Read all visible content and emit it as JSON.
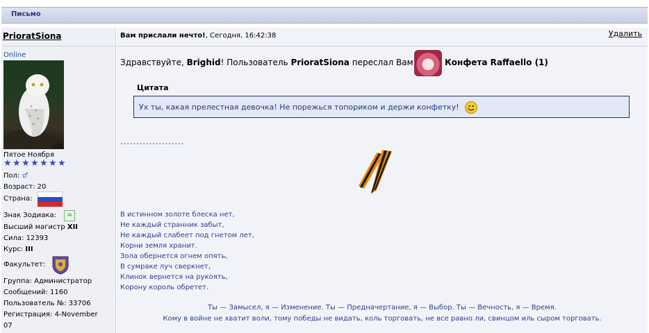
{
  "header": {
    "title": "Письмо"
  },
  "profile": {
    "name": "PrioratSiona",
    "status": "Online",
    "rank": "Пятое Ноября",
    "stars": 7,
    "gender_label": "Пол:",
    "age_label": "Возраст:",
    "age": "20",
    "country_label": "Страна:",
    "zodiac_label": "Знак Зодиака:",
    "magister_label": "Высший магистр",
    "magister_value": "XII",
    "strength_label": "Сила:",
    "strength": "12393",
    "course_label": "Курс:",
    "course": "III",
    "faculty_label": "Факультет:",
    "group": "Группа: Администратор",
    "messages": "Сообщений: 1160",
    "user_no": "Пользователь №: 33706",
    "registration_1": "Регистрация: 4-November",
    "registration_2": "07"
  },
  "message": {
    "subject": "Вам прислали нечто!",
    "date": ", Сегодня, 16:42:38",
    "delete_label": "Удалить",
    "greet_1": "Здравствуйте, ",
    "recipient": "Brighid",
    "greet_2": "! Пользователь ",
    "sender": "PrioratSiona",
    "greet_3": " переслал Вам",
    "gift_name": "Конфета Raffaello (1)",
    "quote_label": "Цитата",
    "quote_text": "Ух ты, какая прелестная девочка! Не порежься топориком и держи конфетку!",
    "separator": "--------------------",
    "poem": [
      "В истинном золоте блеска нет,",
      "Не каждый странник забыт,",
      "Не каждый слабеет под гнетом лет,",
      "Корни земля хранит.",
      "Зола обернется огнем опять,",
      "В сумраке луч сверкнет,",
      "Клинок вернется на рукоять,",
      "Корону король обретет."
    ],
    "signature_1": "Ты — Замысел, я — Изменение. Ты — Предначертание, я — Выбор. Ты — Вечность, я — Время.",
    "signature_2": "Кому в войне не хватит воли, тому победы не видать, коль торговать, не все равно ли, свинцом иль сыром торговать."
  },
  "colors": {
    "header_bg": "#c9cfe3",
    "link": "#1d4f9a",
    "poem": "#2f3f8a",
    "quote_bg": "#e2e8f6"
  },
  "icons": [
    "male-icon",
    "russia-flag-icon",
    "zodiac-icon",
    "faculty-crest-icon",
    "smiley-icon",
    "ribbon-icon",
    "gift-icon"
  ]
}
